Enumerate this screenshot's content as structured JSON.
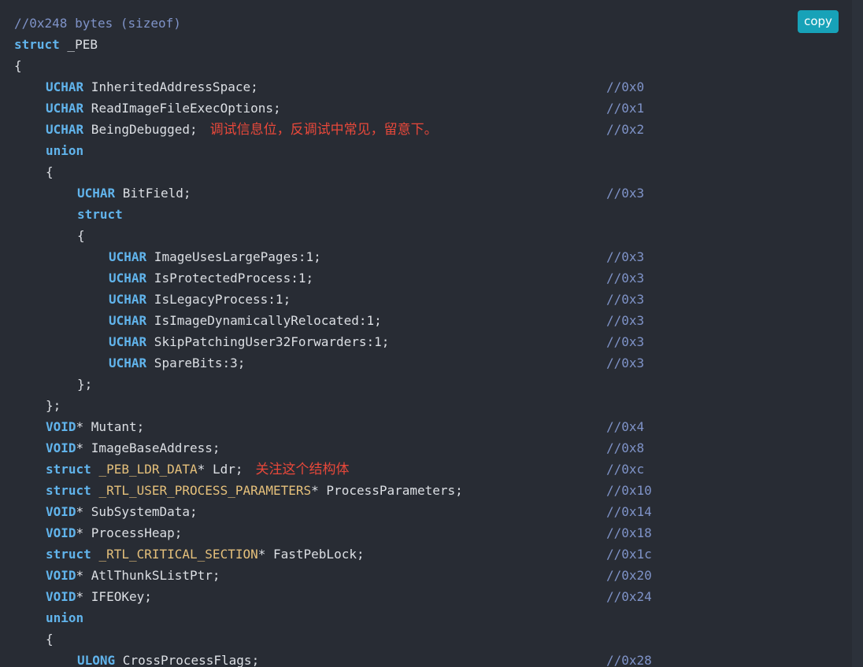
{
  "copy_button": {
    "label": "copy"
  },
  "lines": [
    {
      "indent": 0,
      "parts": [
        {
          "t": "//0x248 bytes (sizeof)",
          "c": "cm"
        }
      ]
    },
    {
      "indent": 0,
      "parts": [
        {
          "t": "struct",
          "c": "kw"
        },
        {
          "t": " _PEB",
          "c": ""
        }
      ]
    },
    {
      "indent": 0,
      "parts": [
        {
          "t": "{",
          "c": ""
        }
      ]
    },
    {
      "indent": 1,
      "parts": [
        {
          "t": "UCHAR",
          "c": "kw"
        },
        {
          "t": " InheritedAddressSpace;",
          "c": ""
        }
      ],
      "offset": "//0x0"
    },
    {
      "indent": 1,
      "parts": [
        {
          "t": "UCHAR",
          "c": "kw"
        },
        {
          "t": " ReadImageFileExecOptions;",
          "c": ""
        }
      ],
      "offset": "//0x1"
    },
    {
      "indent": 1,
      "parts": [
        {
          "t": "UCHAR",
          "c": "kw"
        },
        {
          "t": " BeingDebugged;",
          "c": ""
        }
      ],
      "note": "调试信息位，反调试中常见，留意下。",
      "offset": "//0x2"
    },
    {
      "indent": 1,
      "parts": [
        {
          "t": "union",
          "c": "kw"
        }
      ]
    },
    {
      "indent": 1,
      "parts": [
        {
          "t": "{",
          "c": ""
        }
      ]
    },
    {
      "indent": 2,
      "parts": [
        {
          "t": "UCHAR",
          "c": "kw"
        },
        {
          "t": " BitField;",
          "c": ""
        }
      ],
      "offset": "//0x3"
    },
    {
      "indent": 2,
      "parts": [
        {
          "t": "struct",
          "c": "kw"
        }
      ]
    },
    {
      "indent": 2,
      "parts": [
        {
          "t": "{",
          "c": ""
        }
      ]
    },
    {
      "indent": 3,
      "parts": [
        {
          "t": "UCHAR",
          "c": "kw"
        },
        {
          "t": " ImageUsesLargePages:1;",
          "c": ""
        }
      ],
      "offset": "//0x3"
    },
    {
      "indent": 3,
      "parts": [
        {
          "t": "UCHAR",
          "c": "kw"
        },
        {
          "t": " IsProtectedProcess:1;",
          "c": ""
        }
      ],
      "offset": "//0x3"
    },
    {
      "indent": 3,
      "parts": [
        {
          "t": "UCHAR",
          "c": "kw"
        },
        {
          "t": " IsLegacyProcess:1;",
          "c": ""
        }
      ],
      "offset": "//0x3"
    },
    {
      "indent": 3,
      "parts": [
        {
          "t": "UCHAR",
          "c": "kw"
        },
        {
          "t": " IsImageDynamicallyRelocated:1;",
          "c": ""
        }
      ],
      "offset": "//0x3"
    },
    {
      "indent": 3,
      "parts": [
        {
          "t": "UCHAR",
          "c": "kw"
        },
        {
          "t": " SkipPatchingUser32Forwarders:1;",
          "c": ""
        }
      ],
      "offset": "//0x3"
    },
    {
      "indent": 3,
      "parts": [
        {
          "t": "UCHAR",
          "c": "kw"
        },
        {
          "t": " SpareBits:3;",
          "c": ""
        }
      ],
      "offset": "//0x3"
    },
    {
      "indent": 2,
      "parts": [
        {
          "t": "};",
          "c": ""
        }
      ]
    },
    {
      "indent": 1,
      "parts": [
        {
          "t": "};",
          "c": ""
        }
      ]
    },
    {
      "indent": 1,
      "parts": [
        {
          "t": "VOID",
          "c": "kw"
        },
        {
          "t": "* Mutant;",
          "c": ""
        }
      ],
      "offset": "//0x4"
    },
    {
      "indent": 1,
      "parts": [
        {
          "t": "VOID",
          "c": "kw"
        },
        {
          "t": "* ImageBaseAddress;",
          "c": ""
        }
      ],
      "offset": "//0x8"
    },
    {
      "indent": 1,
      "parts": [
        {
          "t": "struct",
          "c": "kw"
        },
        {
          "t": " ",
          "c": ""
        },
        {
          "t": "_PEB_LDR_DATA",
          "c": "type"
        },
        {
          "t": "* Ldr;",
          "c": ""
        }
      ],
      "note": "关注这个结构体",
      "offset": "//0xc"
    },
    {
      "indent": 1,
      "parts": [
        {
          "t": "struct",
          "c": "kw"
        },
        {
          "t": " ",
          "c": ""
        },
        {
          "t": "_RTL_USER_PROCESS_PARAMETERS",
          "c": "type"
        },
        {
          "t": "* ProcessParameters;",
          "c": ""
        }
      ],
      "offset": "//0x10"
    },
    {
      "indent": 1,
      "parts": [
        {
          "t": "VOID",
          "c": "kw"
        },
        {
          "t": "* SubSystemData;",
          "c": ""
        }
      ],
      "offset": "//0x14"
    },
    {
      "indent": 1,
      "parts": [
        {
          "t": "VOID",
          "c": "kw"
        },
        {
          "t": "* ProcessHeap;",
          "c": ""
        }
      ],
      "offset": "//0x18"
    },
    {
      "indent": 1,
      "parts": [
        {
          "t": "struct",
          "c": "kw"
        },
        {
          "t": " ",
          "c": ""
        },
        {
          "t": "_RTL_CRITICAL_SECTION",
          "c": "type"
        },
        {
          "t": "* FastPebLock;",
          "c": ""
        }
      ],
      "offset": "//0x1c"
    },
    {
      "indent": 1,
      "parts": [
        {
          "t": "VOID",
          "c": "kw"
        },
        {
          "t": "* AtlThunkSListPtr;",
          "c": ""
        }
      ],
      "offset": "//0x20"
    },
    {
      "indent": 1,
      "parts": [
        {
          "t": "VOID",
          "c": "kw"
        },
        {
          "t": "* IFEOKey;",
          "c": ""
        }
      ],
      "offset": "//0x24"
    },
    {
      "indent": 1,
      "parts": [
        {
          "t": "union",
          "c": "kw"
        }
      ]
    },
    {
      "indent": 1,
      "parts": [
        {
          "t": "{",
          "c": ""
        }
      ]
    },
    {
      "indent": 2,
      "parts": [
        {
          "t": "ULONG",
          "c": "kw"
        },
        {
          "t": " CrossProcessFlags;",
          "c": ""
        }
      ],
      "offset": "//0x28"
    }
  ]
}
